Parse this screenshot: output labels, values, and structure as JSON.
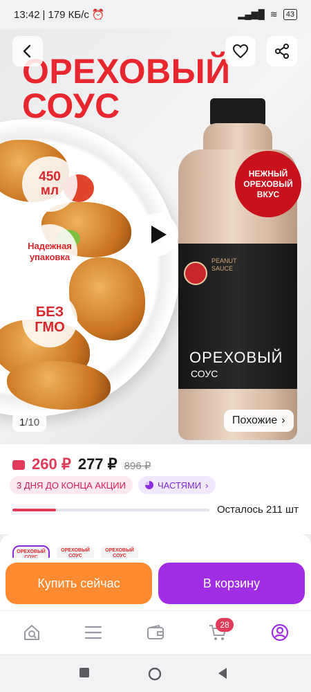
{
  "status_bar": {
    "time": "13:42",
    "separator": "|",
    "speed": "179 КБ/с",
    "battery": "43"
  },
  "hero": {
    "title_line1": "ОРЕХОВЫЙ",
    "title_line2": "СОУС",
    "bubbles": [
      {
        "line1": "450",
        "line2": "мл"
      },
      {
        "line1": "Надежная",
        "line2": "упаковка"
      },
      {
        "line1": "БЕЗ",
        "line2": "ГМО"
      }
    ],
    "red_tag": {
      "line1": "НЕЖНЫЙ",
      "line2": "ОРЕХОВЫЙ",
      "line3": "ВКУС"
    },
    "bottle_label": {
      "line1": "PEANUT",
      "line2": "SAUCE",
      "name": "ОРЕХОВЫЙ",
      "sub": "СОУС"
    },
    "page_current": "1",
    "page_separator": "/",
    "page_total": "10",
    "similar_label": "Похожие",
    "similar_chevron": "›"
  },
  "price": {
    "card_price": "260 ₽",
    "regular_price": "277 ₽",
    "old_price": "896 ₽",
    "promo_chip": "3 ДНЯ ДО КОНЦА АКЦИИ",
    "parts_chip": "ЧАСТЯМИ",
    "parts_chevron": "›",
    "stock_text": "Осталось 211 шт",
    "stock_fraction": 0.22
  },
  "variants": [
    {
      "label": "ОРЕХОВЫЙ СОУС"
    },
    {
      "label": "ОРЕХОВЫЙ СОУС"
    },
    {
      "label": "ОРЕХОВЫЙ СОУС"
    }
  ],
  "actions": {
    "buy_now": "Купить сейчас",
    "add_to_cart": "В корзину"
  },
  "bottom_nav": {
    "items": [
      "home-search-icon",
      "catalog-menu-icon",
      "wallet-icon",
      "cart-icon",
      "profile-icon"
    ],
    "cart_badge": "28"
  },
  "colors": {
    "accent_purple": "#a12ee4",
    "accent_orange": "#ff8a30",
    "price_pink": "#e23a5a",
    "hero_red": "#e8262d"
  }
}
